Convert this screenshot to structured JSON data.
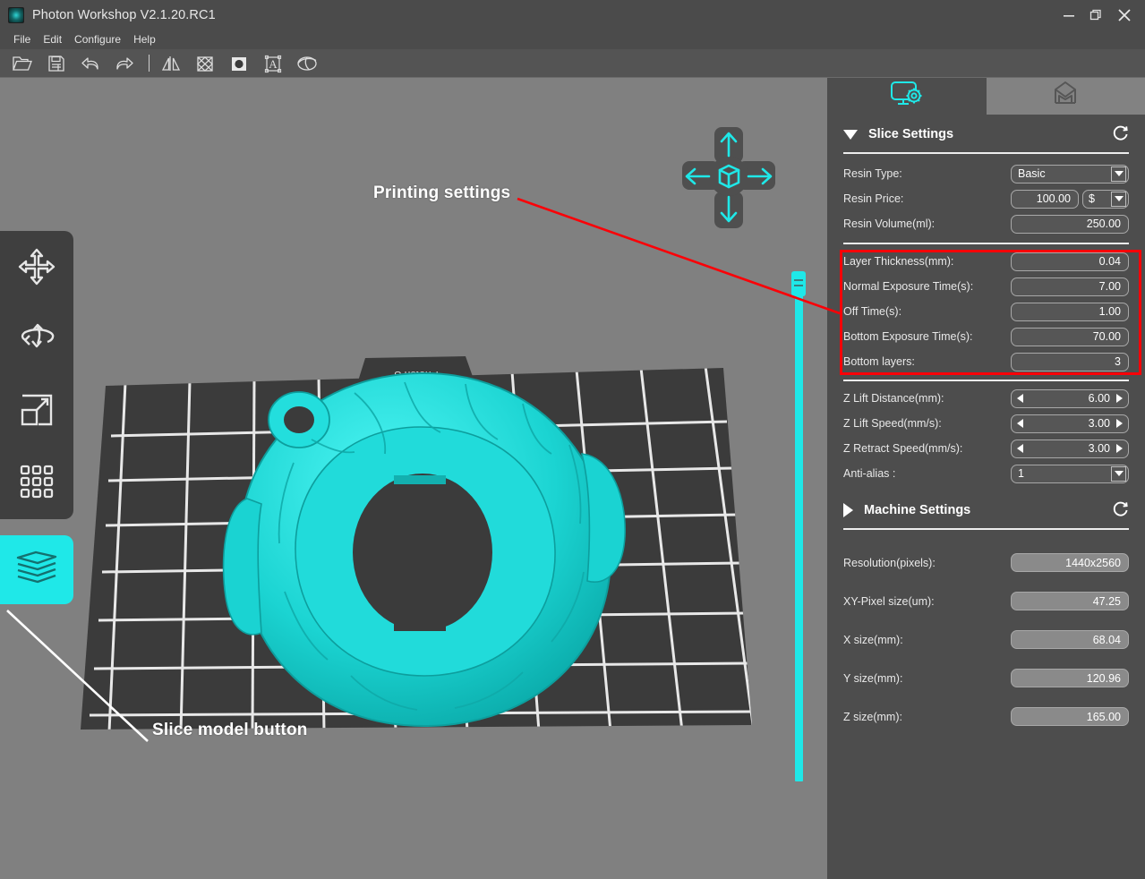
{
  "window": {
    "title": "Photon Workshop V2.1.20.RC1",
    "icon": "app-logo-icon",
    "buttons": {
      "minimize": "minimize-icon",
      "maximize": "maximize-icon",
      "close": "close-icon"
    }
  },
  "menubar": {
    "items": [
      "File",
      "Edit",
      "Configure",
      "Help"
    ]
  },
  "toolbar": {
    "items": [
      {
        "name": "open-file-icon"
      },
      {
        "name": "save-file-icon"
      },
      {
        "name": "undo-icon"
      },
      {
        "name": "redo-icon"
      },
      {
        "name": "mirror-icon"
      },
      {
        "name": "support-icon"
      },
      {
        "name": "hollow-icon"
      },
      {
        "name": "text-icon"
      },
      {
        "name": "slice-preview-icon"
      }
    ]
  },
  "left_rail": {
    "items": [
      {
        "name": "move-tool",
        "icon": "move-arrows-icon"
      },
      {
        "name": "rotate-tool",
        "icon": "rotate-icon"
      },
      {
        "name": "scale-tool",
        "icon": "scale-icon"
      },
      {
        "name": "arrange-tool",
        "icon": "grid-dots-icon"
      }
    ],
    "slice_button": {
      "name": "slice-model-button",
      "icon": "layers-icon"
    }
  },
  "viewport": {
    "plate_label": "Photon S",
    "gizmo": {
      "up": "arrow-up-icon",
      "down": "arrow-down-icon",
      "left": "arrow-left-icon",
      "right": "arrow-right-icon",
      "center": "cube-icon"
    },
    "z_slider": {
      "name": "z-height-slider",
      "value": ""
    }
  },
  "annotations": [
    {
      "id": "printing-settings",
      "text": "Printing settings",
      "color": "#fb0007"
    },
    {
      "id": "slice-model-button",
      "text": "Slice model button",
      "color": "#ffffff"
    }
  ],
  "panel": {
    "tabs": [
      {
        "name": "tab-slice-settings",
        "icon": "monitor-gear-icon",
        "active": true
      },
      {
        "name": "tab-machine-preview",
        "icon": "printer-box-icon",
        "active": false
      }
    ],
    "slice_settings": {
      "title": "Slice Settings",
      "collapsed": false,
      "refresh_icon": "refresh-icon",
      "group_resin": [
        {
          "label": "Resin Type:",
          "value": "Basic",
          "control": "combobox"
        },
        {
          "label": "Resin Price:",
          "value": "100.00",
          "unit": "$",
          "control": "number-with-unit"
        },
        {
          "label": "Resin Volume(ml):",
          "value": "250.00",
          "control": "number"
        }
      ],
      "group_exposure": [
        {
          "label": "Layer Thickness(mm):",
          "value": "0.04",
          "control": "number"
        },
        {
          "label": "Normal Exposure Time(s):",
          "value": "7.00",
          "control": "number"
        },
        {
          "label": "Off Time(s):",
          "value": "1.00",
          "control": "number"
        },
        {
          "label": "Bottom Exposure Time(s):",
          "value": "70.00",
          "control": "number"
        },
        {
          "label": "Bottom layers:",
          "value": "3",
          "control": "number"
        }
      ],
      "group_motion": [
        {
          "label": "Z Lift Distance(mm):",
          "value": "6.00",
          "control": "spinner"
        },
        {
          "label": "Z Lift Speed(mm/s):",
          "value": "3.00",
          "control": "spinner"
        },
        {
          "label": "Z Retract Speed(mm/s):",
          "value": "3.00",
          "control": "spinner"
        },
        {
          "label": "Anti-alias :",
          "value": "1",
          "control": "combobox"
        }
      ]
    },
    "machine_settings": {
      "title": "Machine Settings",
      "collapsed": true,
      "refresh_icon": "refresh-icon",
      "rows": [
        {
          "label": "Resolution(pixels):",
          "value": "1440x2560"
        },
        {
          "label": "XY-Pixel size(um):",
          "value": "47.25"
        },
        {
          "label": "X size(mm):",
          "value": "68.04"
        },
        {
          "label": "Y size(mm):",
          "value": "120.96"
        },
        {
          "label": "Z size(mm):",
          "value": "165.00"
        }
      ]
    }
  },
  "colors": {
    "accent_cyan": "#1fe8e8",
    "model_cyan": "#1ed6d6",
    "highlight_red": "#fb0007",
    "panel_bg": "#4d4d4d",
    "viewport_bg": "#808080",
    "titlebar_bg": "#4b4b4b"
  }
}
